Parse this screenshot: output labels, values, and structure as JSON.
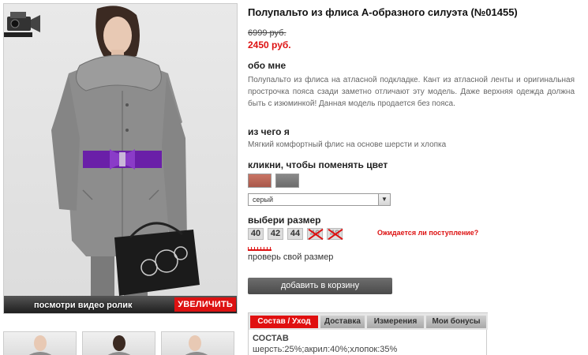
{
  "gallery": {
    "video_label": "посмотри видео ролик",
    "zoom_label": "УВЕЛИЧИТЬ"
  },
  "product": {
    "title": "Полупальто из флиса А-образного силуэта (№01455)",
    "old_price": "6999 руб.",
    "new_price": "2450 руб.",
    "about_heading": "обо мне",
    "about_text": "Полупальто из флиса на атласной подкладке. Кант из атласной ленты и оригинальная прострочка пояса сзади заметно отличают эту модель. Даже верхняя одежда должна быть с изюминкой! Данная модель продается без пояса.",
    "material_heading": "из чего я",
    "material_text": "Мягкий комфортный флис на основе шерсти и хлопка",
    "color_heading": "кликни, чтобы поменять цвет",
    "color_selected": "серый",
    "size_heading": "выбери размер",
    "sizes": [
      {
        "label": "40",
        "available": true
      },
      {
        "label": "42",
        "available": true
      },
      {
        "label": "44",
        "available": true
      },
      {
        "label": "46",
        "available": false
      },
      {
        "label": "48",
        "available": false
      }
    ],
    "waitlist_link": "Ожидается ли поступление?",
    "check_size_link": "проверь свой размер",
    "add_to_cart_label": "добавить в корзину"
  },
  "tabs": {
    "items": [
      "Состав / Уход",
      "Доставка",
      "Измерения",
      "Мои бонусы"
    ],
    "content_heading": "СОСТАВ",
    "content_text": "шерсть:25%;акрил:40%;хлопок:35%"
  },
  "colors": {
    "accent": "#dd1111",
    "swatch_terracotta": "#b8604f",
    "swatch_gray": "#7a7a7a"
  }
}
